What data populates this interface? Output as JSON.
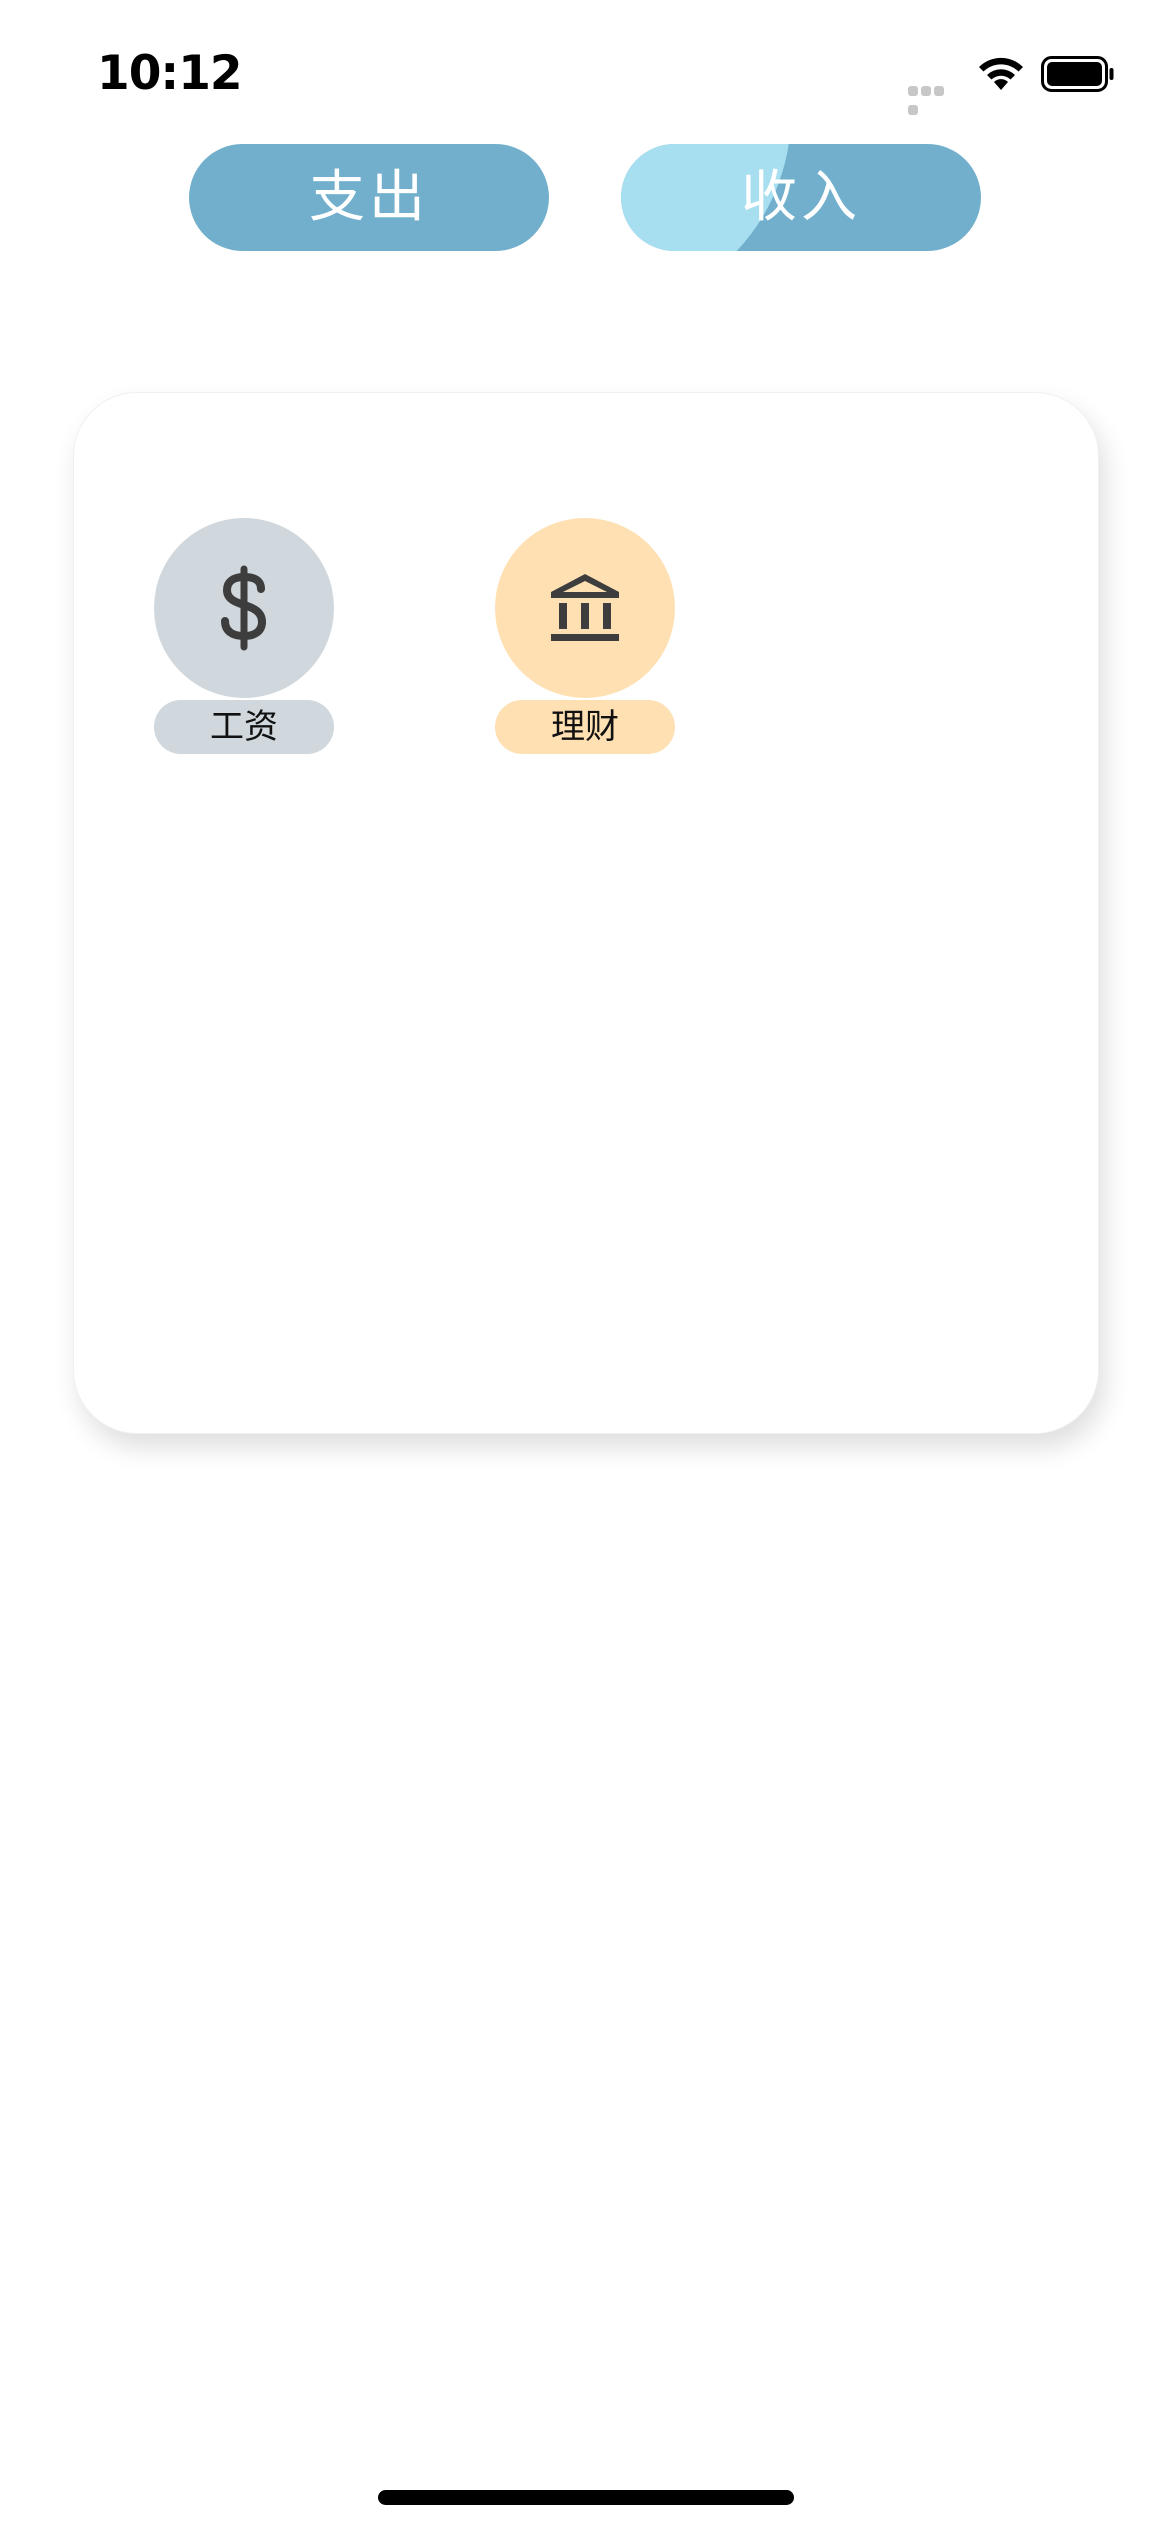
{
  "status_bar": {
    "time": "10:12",
    "icons": [
      "cellular-signal-icon",
      "wifi-icon",
      "battery-icon"
    ]
  },
  "segments": {
    "expense_label": "支出",
    "income_label": "收入",
    "selected": "income"
  },
  "categories": [
    {
      "label": "工资",
      "icon": "dollar-icon",
      "color": "#d0d8dd"
    },
    {
      "label": "理财",
      "icon": "bank-icon",
      "color": "#ffe0b3"
    }
  ],
  "colors": {
    "accent": "#71afcc",
    "ripple": "#a8dff0",
    "icon": "#3d3d3d"
  }
}
